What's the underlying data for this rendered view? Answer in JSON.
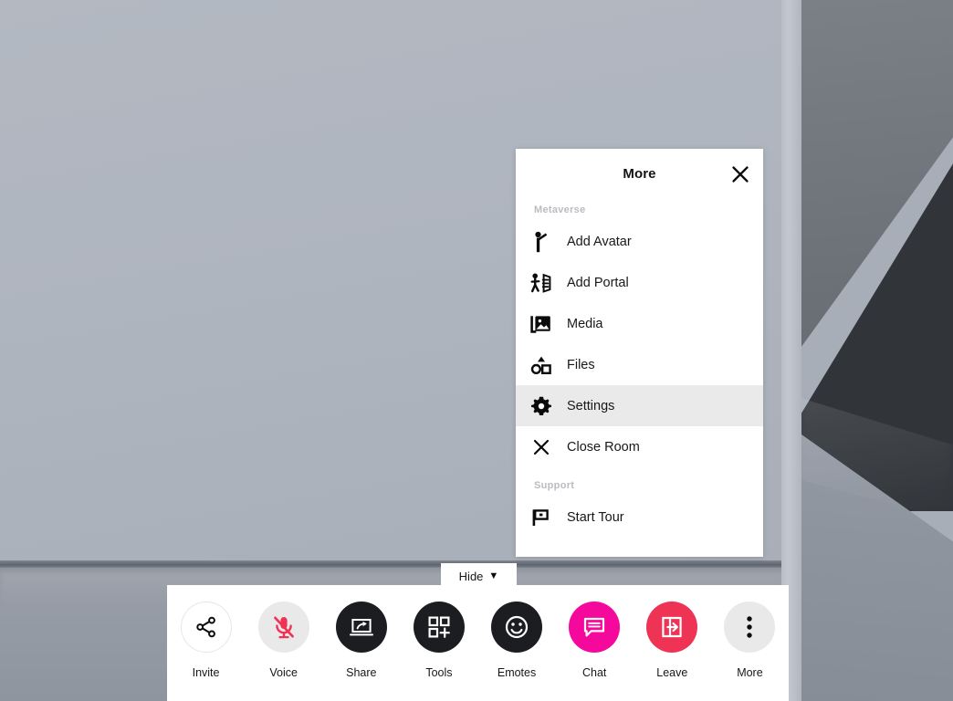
{
  "scene": {
    "description": "3d-metaverse-room-background",
    "wall_color": "#b0b6c0",
    "dark_wall_color": "#31353a",
    "floor_color": "#939aa4"
  },
  "more_panel": {
    "title": "More",
    "close_icon": "close-icon",
    "groups": [
      {
        "label": "Metaverse",
        "items": [
          {
            "label": "Add Avatar",
            "icon": "person-raised-arm-icon",
            "active": false
          },
          {
            "label": "Add Portal",
            "icon": "person-portal-icon",
            "active": false
          },
          {
            "label": "Media",
            "icon": "images-stack-icon",
            "active": false
          },
          {
            "label": "Files",
            "icon": "shapes-icon",
            "active": false
          },
          {
            "label": "Settings",
            "icon": "gear-icon",
            "active": true
          },
          {
            "label": "Close Room",
            "icon": "close-icon",
            "active": false
          }
        ]
      },
      {
        "label": "Support",
        "items": [
          {
            "label": "Start Tour",
            "icon": "flag-icon",
            "active": false
          }
        ]
      }
    ]
  },
  "hide_button": {
    "label": "Hide",
    "caret": "▼"
  },
  "toolbar": {
    "items": [
      {
        "label": "Invite",
        "icon": "share-nodes-icon",
        "style": "outline",
        "color": "#ffffff"
      },
      {
        "label": "Voice",
        "icon": "microphone-muted-icon",
        "style": "gray",
        "color": "#e9e9e9"
      },
      {
        "label": "Share",
        "icon": "screen-share-icon",
        "style": "dark",
        "color": "#1c1d20"
      },
      {
        "label": "Tools",
        "icon": "grid-plus-icon",
        "style": "dark",
        "color": "#1c1d20"
      },
      {
        "label": "Emotes",
        "icon": "smiley-face-icon",
        "style": "dark",
        "color": "#1c1d20"
      },
      {
        "label": "Chat",
        "icon": "chat-bubble-icon",
        "style": "magenta",
        "color": "#f5089c"
      },
      {
        "label": "Leave",
        "icon": "exit-arrow-icon",
        "style": "red",
        "color": "#ef3355"
      },
      {
        "label": "More",
        "icon": "three-dots-icon",
        "style": "gray",
        "color": "#e9e9e9"
      }
    ]
  }
}
